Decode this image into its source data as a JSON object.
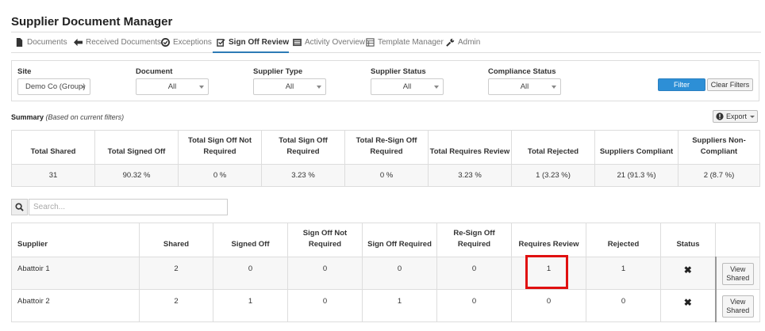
{
  "app": {
    "title": "Supplier Document Manager"
  },
  "tabs": [
    {
      "label": "Documents",
      "icon": "file-icon"
    },
    {
      "label": "Received Documents",
      "icon": "arrow-left-icon"
    },
    {
      "label": "Exceptions",
      "icon": "circle-check-icon"
    },
    {
      "label": "Sign Off Review",
      "icon": "edit-check-icon",
      "active": true
    },
    {
      "label": "Activity Overview",
      "icon": "list-icon"
    },
    {
      "label": "Template Manager",
      "icon": "table-icon"
    },
    {
      "label": "Admin",
      "icon": "wrench-icon"
    }
  ],
  "filters": {
    "site": {
      "label": "Site",
      "value": "Demo Co (Group)"
    },
    "document": {
      "label": "Document",
      "value": "All"
    },
    "supplier_type": {
      "label": "Supplier Type",
      "value": "All"
    },
    "supplier_status": {
      "label": "Supplier Status",
      "value": "All"
    },
    "compliance_status": {
      "label": "Compliance Status",
      "value": "All"
    },
    "filter_button": "Filter",
    "clear_button": "Clear Filters"
  },
  "summary": {
    "title": "Summary",
    "subtitle": "(Based on current filters)",
    "export_button": "Export",
    "headers": [
      "Total Shared",
      "Total Signed Off",
      "Total Sign Off Not Required",
      "Total Sign Off Required",
      "Total Re-Sign Off Required",
      "Total Requires Review",
      "Total Rejected",
      "Suppliers Compliant",
      "Suppliers Non-Compliant"
    ],
    "values": [
      "31",
      "90.32 %",
      "0 %",
      "3.23 %",
      "0 %",
      "3.23 %",
      "1 (3.23 %)",
      "21 (91.3 %)",
      "2 (8.7 %)"
    ]
  },
  "search": {
    "placeholder": "Search..."
  },
  "table": {
    "headers": [
      "Supplier",
      "Shared",
      "Signed Off",
      "Sign Off Not Required",
      "Sign Off Required",
      "Re-Sign Off Required",
      "Requires Review",
      "Rejected",
      "Status",
      ""
    ],
    "rows": [
      {
        "supplier": "Abattoir 1",
        "shared": "2",
        "signed_off": "0",
        "not_required": "0",
        "required": "0",
        "resign_required": "0",
        "requires_review": "1",
        "rejected": "1",
        "status_icon": "x-icon",
        "action": "View Shared"
      },
      {
        "supplier": "Abattoir 2",
        "shared": "2",
        "signed_off": "1",
        "not_required": "0",
        "required": "1",
        "resign_required": "0",
        "requires_review": "0",
        "rejected": "0",
        "status_icon": "x-icon",
        "action": "View Shared"
      }
    ]
  },
  "colors": {
    "accent": "#2d8fd6",
    "tab_underline": "#2d7bb6",
    "highlight": "#e01010"
  }
}
